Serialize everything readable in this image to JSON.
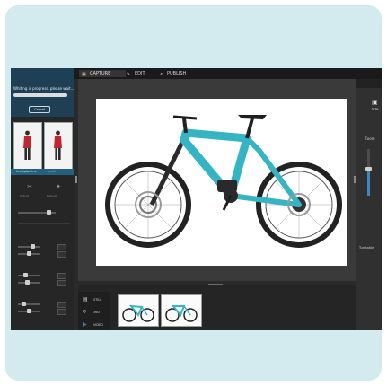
{
  "left_panel": {
    "progress_text": "Whiting is progress, please wait...",
    "cancel_label": "Cancel",
    "selection_label": "tech/pipeline",
    "selection_label_2": "walk",
    "tools": [
      {
        "icon": "scissors-icon",
        "label": "Cutout"
      },
      {
        "icon": "magic-icon",
        "label": "Retouch"
      }
    ]
  },
  "top_tabs": [
    {
      "label": "CAPTURE",
      "icon": "camera-icon",
      "active": true
    },
    {
      "label": "EDIT",
      "icon": "edit-icon",
      "active": false
    },
    {
      "label": "PUBLISH",
      "icon": "publish-icon",
      "active": false
    }
  ],
  "filmstrip": {
    "items": [
      {
        "label": "STILL",
        "icon": "image-icon"
      },
      {
        "label": "360",
        "icon": "rotate-icon"
      },
      {
        "label": "VIDEO",
        "icon": "video-icon"
      }
    ]
  },
  "right_panel": {
    "still_label": "STILL",
    "zoom_label": "Zoom",
    "turntable_label": "Turntable",
    "zoom_level": 0.55
  },
  "colors": {
    "background": "#d3ebef",
    "accent": "#3d86c6",
    "bike_frame": "#35b4c4"
  }
}
